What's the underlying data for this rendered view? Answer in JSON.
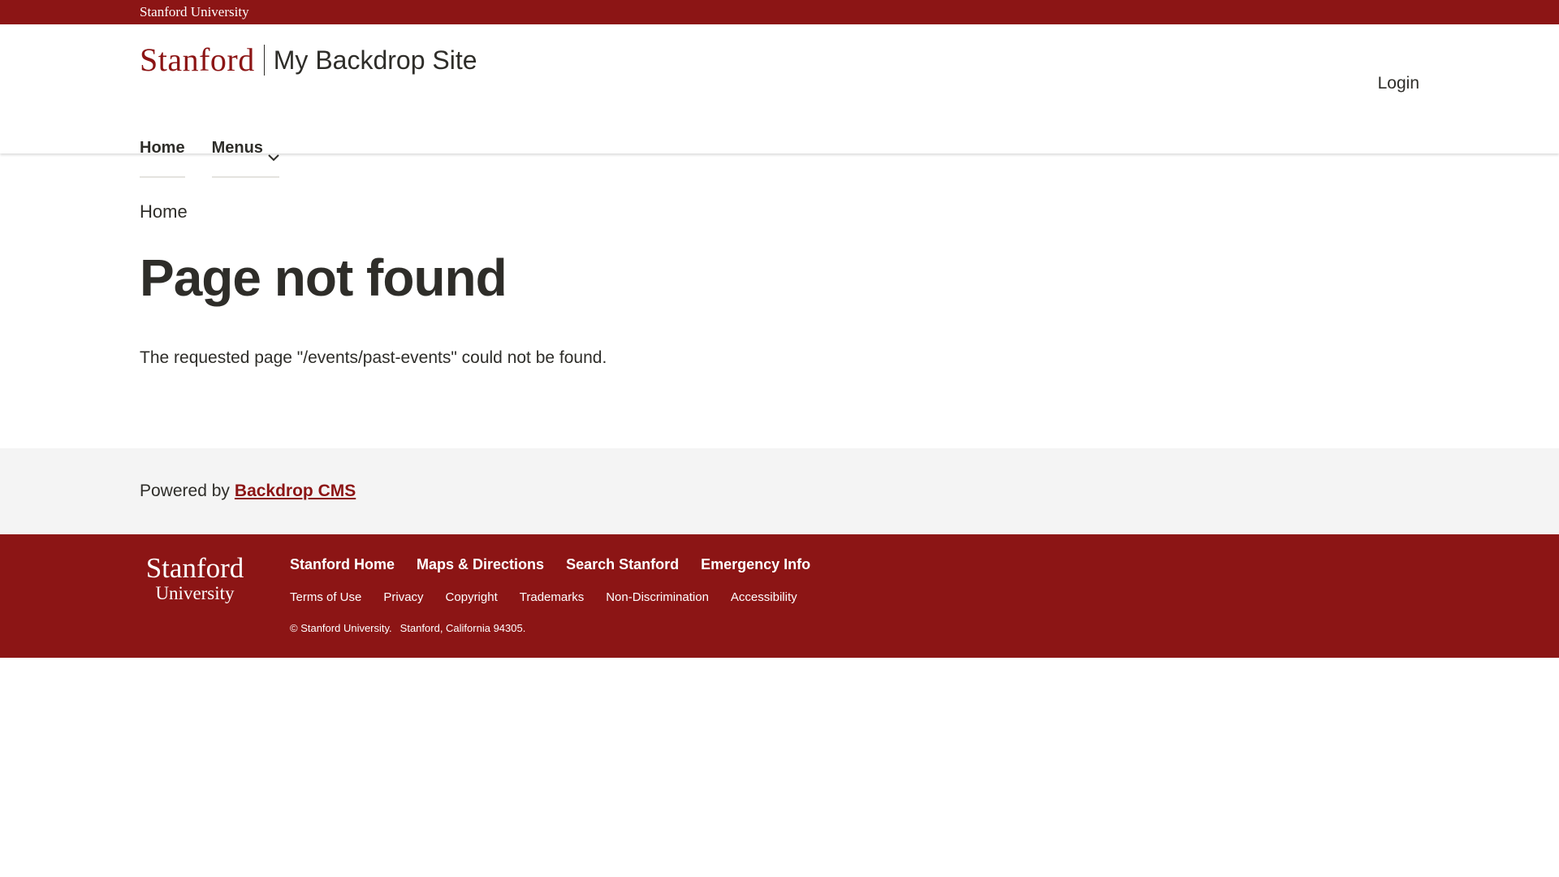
{
  "brand_bar": {
    "label": "Stanford University"
  },
  "header": {
    "wordmark": "Stanford",
    "site_name": "My Backdrop Site",
    "login": "Login"
  },
  "nav": {
    "items": [
      {
        "label": "Home"
      },
      {
        "label": "Menus"
      }
    ]
  },
  "main": {
    "breadcrumb": "Home",
    "title": "Page not found",
    "message": "The requested page \"/events/past-events\" could not be found."
  },
  "powered": {
    "prefix": "Powered by",
    "link": "Backdrop CMS"
  },
  "global_footer": {
    "logo_line1": "Stanford",
    "logo_line2": "University",
    "main_links": [
      "Stanford Home",
      "Maps & Directions",
      "Search Stanford",
      "Emergency Info"
    ],
    "sub_links": [
      "Terms of Use",
      "Privacy",
      "Copyright",
      "Trademarks",
      "Non-Discrimination",
      "Accessibility"
    ],
    "copyright": "© Stanford University.",
    "address": "Stanford, California 94305."
  },
  "colors": {
    "cardinal": "#8c1515",
    "text": "#2e2d29",
    "powered_bg": "#f4f4f4"
  }
}
